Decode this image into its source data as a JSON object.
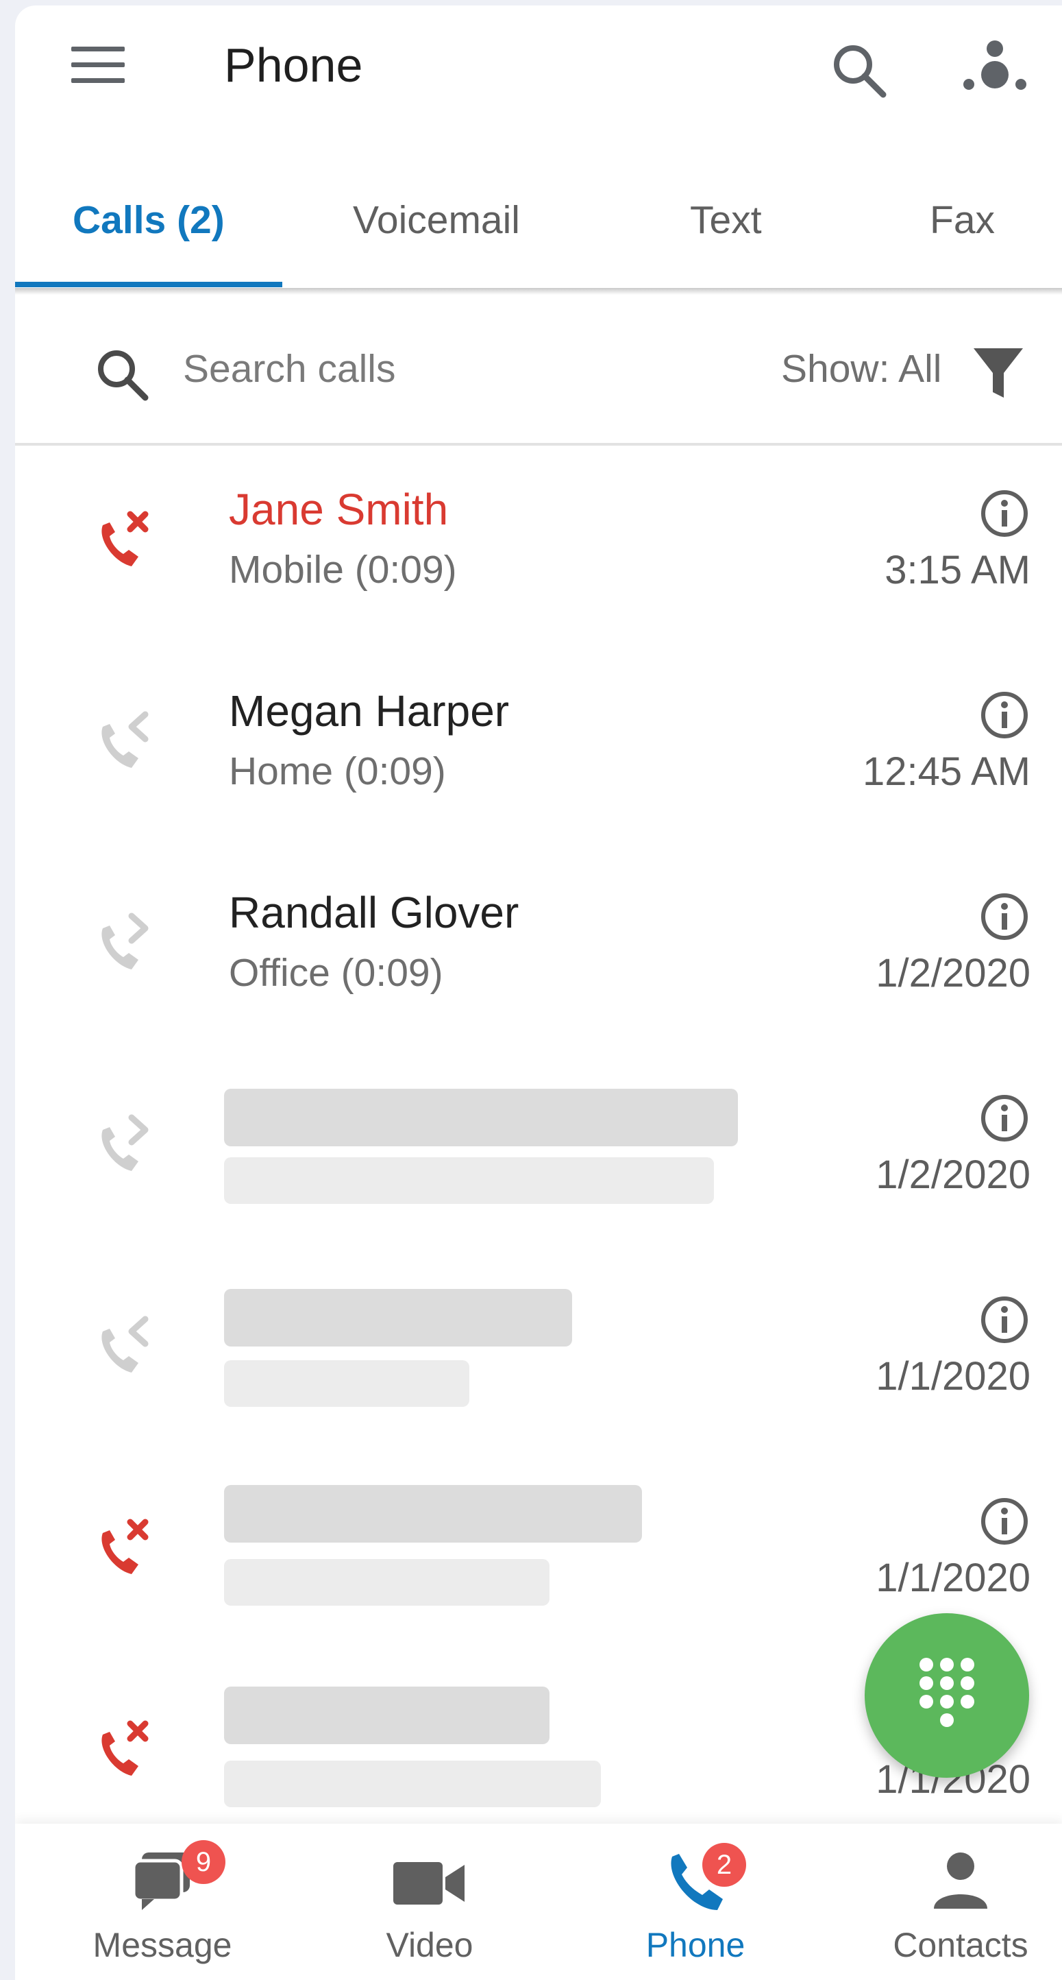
{
  "app": {
    "title": "Phone"
  },
  "tabs": [
    {
      "label": "Calls (2)",
      "active": true
    },
    {
      "label": "Voicemail",
      "active": false
    },
    {
      "label": "Text",
      "active": false
    },
    {
      "label": "Fax",
      "active": false
    }
  ],
  "search": {
    "placeholder": "Search calls",
    "filter_label": "Show: All"
  },
  "calls": [
    {
      "type": "missed",
      "name": "Jane Smith",
      "detail": "Mobile (0:09)",
      "time": "3:15 AM"
    },
    {
      "type": "incoming",
      "name": "Megan Harper",
      "detail": "Home (0:09)",
      "time": "12:45 AM"
    },
    {
      "type": "outgoing",
      "name": "Randall Glover",
      "detail": "Office (0:09)",
      "time": "1/2/2020"
    },
    {
      "type": "outgoing",
      "name": "",
      "detail": "",
      "time": "1/2/2020"
    },
    {
      "type": "incoming",
      "name": "",
      "detail": "",
      "time": "1/1/2020"
    },
    {
      "type": "missed",
      "name": "",
      "detail": "",
      "time": "1/1/2020"
    },
    {
      "type": "missed",
      "name": "",
      "detail": "",
      "time": "1/1/2020"
    }
  ],
  "bottom_nav": [
    {
      "label": "Message",
      "badge": "9",
      "icon": "message-icon",
      "active": false
    },
    {
      "label": "Video",
      "badge": "",
      "icon": "video-icon",
      "active": false
    },
    {
      "label": "Phone",
      "badge": "2",
      "icon": "phone-icon",
      "active": true
    },
    {
      "label": "Contacts",
      "badge": "",
      "icon": "contacts-icon",
      "active": false
    }
  ],
  "colors": {
    "accent": "#1178be",
    "missed": "#d93a31",
    "fab": "#5cb85c",
    "badge": "#ef5350"
  },
  "fab": {
    "icon": "dialpad-icon"
  }
}
